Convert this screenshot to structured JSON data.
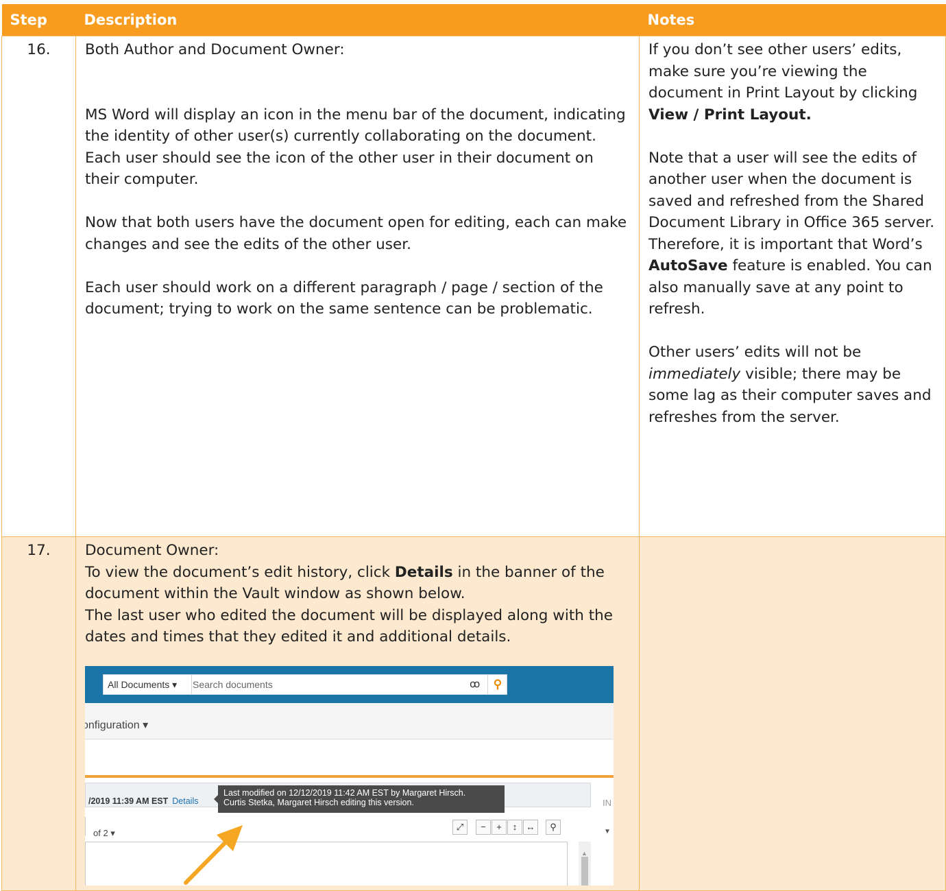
{
  "header": {
    "step": "Step",
    "description": "Description",
    "notes": "Notes"
  },
  "row16": {
    "step": "16.",
    "description": [
      "Both Author and Document Owner:",
      "MS Word will display an icon in the menu bar of the document, indicating the identity of other user(s) currently collaborating on the document. Each user should see the icon of the other user in their document on their computer.",
      "Now that both users have the document open for editing, each can make changes and see the edits of the other user.",
      "Each user should work on a different paragraph / page / section of the document; trying to work on the same sentence can be problematic."
    ],
    "notes": {
      "p1_text": "If you don’t see other users’ edits, make sure you’re viewing the document in Print Layout by clicking",
      "p1_bold": "View / Print Layout.",
      "p2_text": "Note that a user will see the edits of another user when the document is saved and refreshed from the Shared Document Library in Office 365 server. Therefore, it is important that Word’s",
      "p2_bold": "AutoSave",
      "p2_tail": "feature is enabled. You can also manually save at any point to refresh.",
      "p3_italic": "immediately",
      "p3_head": "Other users’ edits will not be",
      "p3_tail": "visible; there may be some lag as their computer saves and refreshes from the server."
    }
  },
  "row17": {
    "step": "17.",
    "line1": "Document Owner:",
    "line2_a": "To view the document’s edit history, click",
    "line2_bold": "Details",
    "line2_b": "in the banner of the document within the Vault window as shown below.",
    "line3": "The last user who edited the document will be displayed along with the dates and times that they edited it and additional details."
  },
  "screenshot": {
    "all_documents": "All Documents ▾",
    "search_placeholder": "Search documents",
    "configuration": "onfiguration ▾",
    "banner_time": "/2019 11:39 AM EST",
    "details_link": "Details",
    "tooltip_line1": "Last modified on 12/12/2019 11:42 AM EST by Margaret Hirsch.",
    "tooltip_line2": "Curtis Stetka, Margaret Hirsch editing this version.",
    "side_label": "IN",
    "of_pages": "of 2 ▾",
    "arrow_color": "#f5a623",
    "accent_color": "#1b74a8"
  },
  "colors": {
    "header_bg": "#f79c1f",
    "row17_bg": "#fde9cf",
    "border": "#f3b45c"
  }
}
